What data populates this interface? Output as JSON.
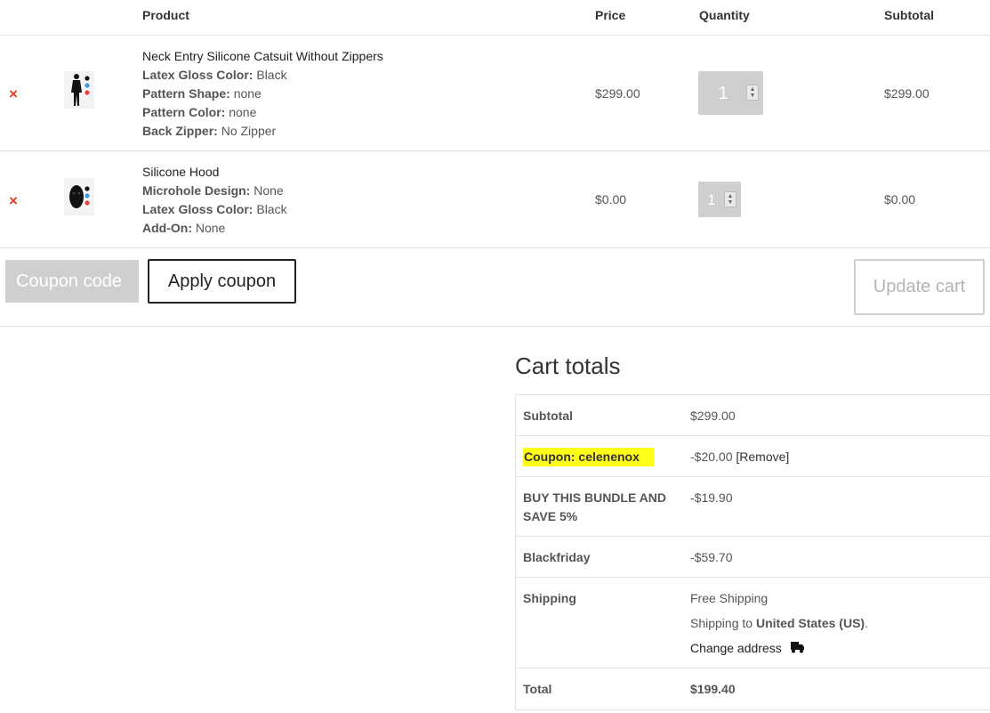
{
  "table": {
    "headers": {
      "product": "Product",
      "price": "Price",
      "quantity": "Quantity",
      "subtotal": "Subtotal"
    }
  },
  "items": [
    {
      "remove": "×",
      "name": "Neck Entry Silicone Catsuit Without Zippers",
      "meta": [
        {
          "label": "Latex Gloss Color:",
          "value": "Black"
        },
        {
          "label": "Pattern Shape:",
          "value": "none"
        },
        {
          "label": "Pattern Color:",
          "value": "none"
        },
        {
          "label": "Back Zipper:",
          "value": "No Zipper"
        }
      ],
      "price": "$299.00",
      "quantity": "1",
      "subtotal": "$299.00"
    },
    {
      "remove": "×",
      "name": "Silicone Hood",
      "meta": [
        {
          "label": "Microhole Design:",
          "value": "None"
        },
        {
          "label": "Latex Gloss Color:",
          "value": "Black"
        },
        {
          "label": "Add-On:",
          "value": "None"
        }
      ],
      "price": "$0.00",
      "quantity": "1",
      "subtotal": "$0.00"
    }
  ],
  "coupon": {
    "placeholder": "Coupon code",
    "apply_label": "Apply coupon",
    "update_label": "Update cart"
  },
  "totals": {
    "title": "Cart totals",
    "subtotal_label": "Subtotal",
    "subtotal_value": "$299.00",
    "coupon_label": "Coupon: celenenox",
    "coupon_value": "-$20.00",
    "coupon_remove": "[Remove]",
    "bundle_label_line1": "BUY THIS BUNDLE AND",
    "bundle_label_line2": "SAVE 5%",
    "bundle_value": "-$19.90",
    "blackfriday_label": "Blackfriday",
    "blackfriday_value": "-$59.70",
    "shipping_label": "Shipping",
    "shipping_method": "Free Shipping",
    "shipping_to_prefix": "Shipping to ",
    "shipping_to_country": "United States (US)",
    "shipping_to_suffix": ".",
    "change_address": "Change address",
    "total_label": "Total",
    "total_value": "$199.40"
  },
  "colors": {
    "remove": "#e2401c",
    "highlight": "#ffff1a",
    "qty_box": "#cfcfcf"
  },
  "icons": {
    "remove": "remove-x-icon",
    "truck": "truck-icon"
  }
}
